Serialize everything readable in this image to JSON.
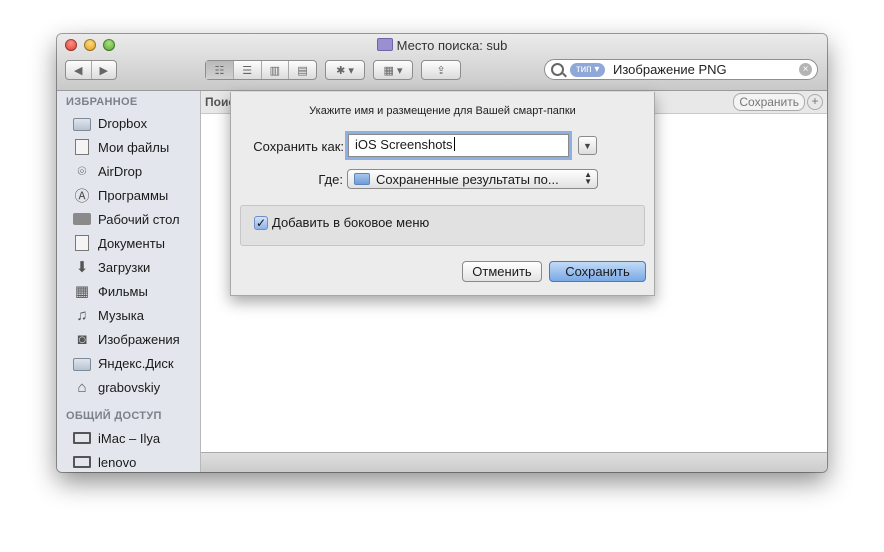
{
  "window": {
    "title": "Место поиска: sub"
  },
  "search": {
    "token": "тип ▾",
    "value": "Изображение PNG",
    "clear": "×"
  },
  "sidebar": {
    "favorites_header": "ИЗБРАННОЕ",
    "favorites": [
      {
        "label": "Dropbox",
        "icon": "folder-icon"
      },
      {
        "label": "Мои файлы",
        "icon": "all-files-icon"
      },
      {
        "label": "AirDrop",
        "icon": "airdrop-icon"
      },
      {
        "label": "Программы",
        "icon": "applications-icon"
      },
      {
        "label": "Рабочий стол",
        "icon": "desktop-icon"
      },
      {
        "label": "Документы",
        "icon": "documents-icon"
      },
      {
        "label": "Загрузки",
        "icon": "downloads-icon"
      },
      {
        "label": "Фильмы",
        "icon": "movies-icon"
      },
      {
        "label": "Музыка",
        "icon": "music-icon"
      },
      {
        "label": "Изображения",
        "icon": "pictures-icon"
      },
      {
        "label": "Яндекс.Диск",
        "icon": "folder-icon"
      },
      {
        "label": "grabovskiy",
        "icon": "home-icon"
      }
    ],
    "shared_header": "ОБЩИЙ ДОСТУП",
    "shared": [
      {
        "label": "iMac – Ilya",
        "icon": "imac-icon"
      },
      {
        "label": "lenovo",
        "icon": "pc-icon"
      }
    ]
  },
  "criteria_bar": {
    "left_label": "Поис",
    "save_button": "Сохранить",
    "add_button": "+"
  },
  "sheet": {
    "message": "Укажите имя и размещение для Вашей смарт-папки",
    "save_as_label": "Сохранить как:",
    "save_as_value": "iOS Screenshots",
    "where_label": "Где:",
    "where_value": "Сохраненные результаты по...",
    "add_to_sidebar_label": "Добавить в боковое меню",
    "add_to_sidebar_checked": true,
    "cancel_button": "Отменить",
    "save_button": "Сохранить"
  }
}
